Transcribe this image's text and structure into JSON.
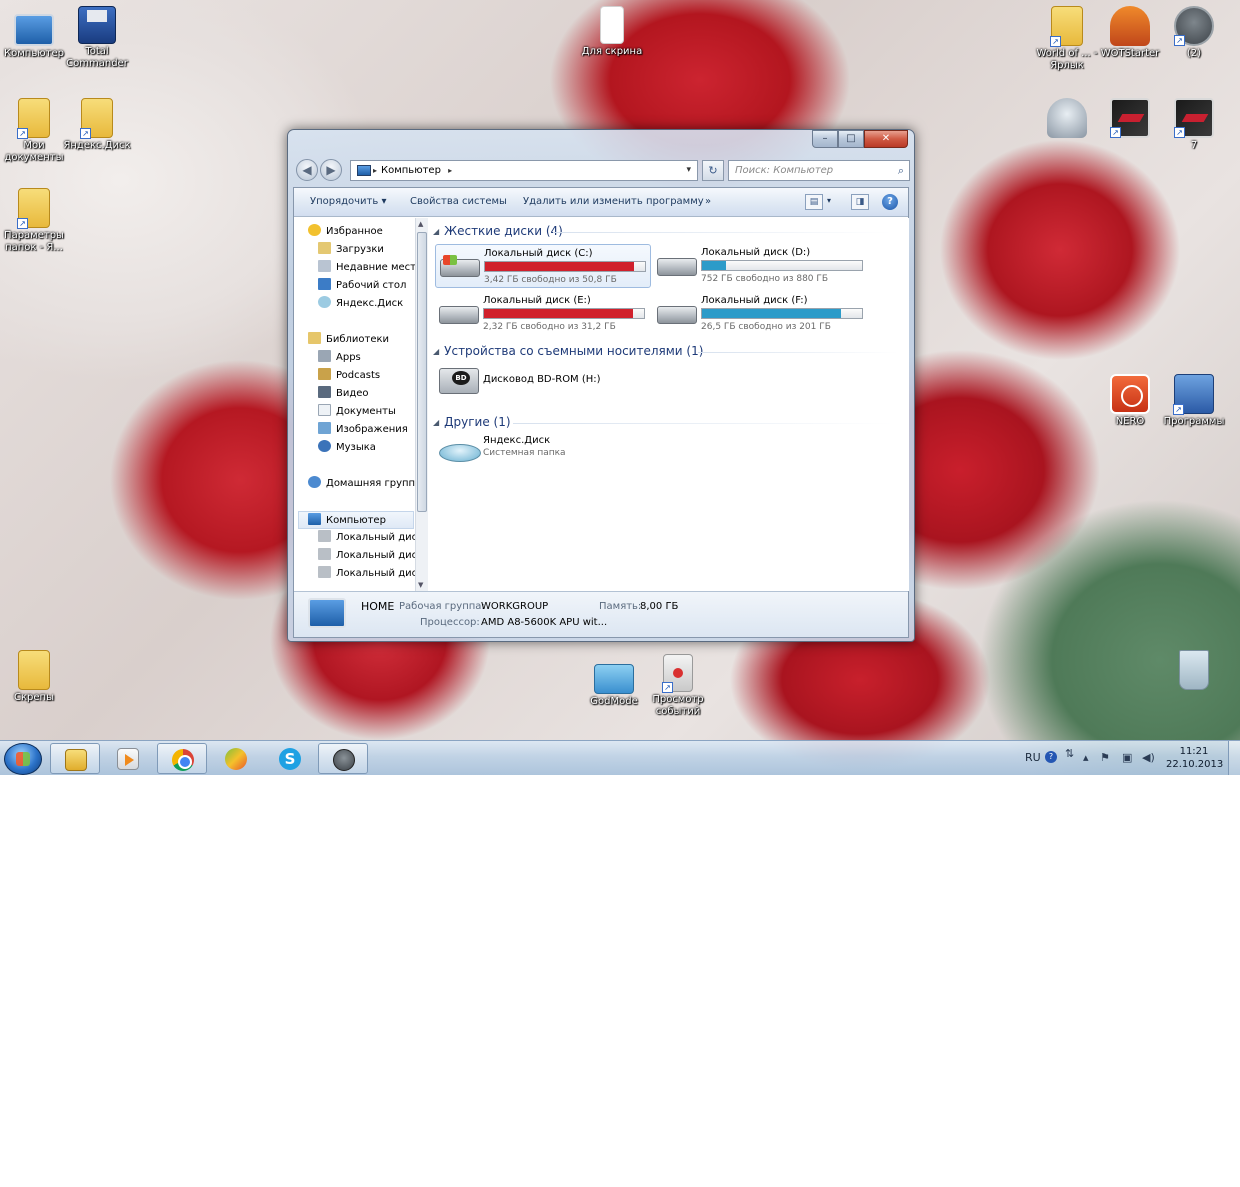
{
  "desktop": {
    "icons_left": [
      {
        "label": "Компьютер",
        "icon": "computer-icon"
      },
      {
        "label": "Total Commander",
        "icon": "floppy-icon"
      },
      {
        "label": "Мои документы",
        "icon": "folder-icon"
      },
      {
        "label": "Яндекс.Диск",
        "icon": "folder-icon"
      },
      {
        "label": "Параметры папок - Я...",
        "icon": "folder-icon"
      },
      {
        "label": "Скрепы",
        "icon": "folder-icon"
      }
    ],
    "icon_for_screenshot": {
      "label": "Для скрина",
      "icon": "blank-file-icon"
    },
    "icons_right": [
      {
        "label": "World of ... - Ярлык",
        "icon": "folder-icon"
      },
      {
        "label": "WOTStarter",
        "icon": "house-icon"
      },
      {
        "label": "(2)",
        "icon": "tank-icon"
      },
      {
        "label": "",
        "icon": "bell-icon"
      },
      {
        "label": "",
        "icon": "nfs-icon"
      },
      {
        "label": "7",
        "icon": "nfs-icon"
      },
      {
        "label": "NERO",
        "icon": "nero-icon"
      },
      {
        "label": "Программы",
        "icon": "programs-icon"
      }
    ],
    "icons_bottom": [
      {
        "label": "GodMode",
        "icon": "control-panel-icon"
      },
      {
        "label": "Просмотр событий",
        "icon": "event-viewer-icon"
      },
      {
        "label": "",
        "icon": "recycle-bin-icon"
      }
    ]
  },
  "window": {
    "caption_buttons": {
      "minimize": "–",
      "maximize": "□",
      "close": "✕"
    },
    "nav": {
      "back": "◀",
      "forward": "▶"
    },
    "address": {
      "path": "Компьютер",
      "separator": "▸"
    },
    "search": {
      "placeholder": "Поиск: Компьютер"
    },
    "commands": [
      "Упорядочить ▾",
      "Свойства системы",
      "Удалить или изменить программу",
      "»"
    ],
    "nav_pane": {
      "favorites": {
        "title": "Избранное",
        "items": [
          "Загрузки",
          "Недавние места",
          "Рабочий стол",
          "Яндекс.Диск"
        ]
      },
      "libraries": {
        "title": "Библиотеки",
        "items": [
          "Apps",
          "Podcasts",
          "Видео",
          "Документы",
          "Изображения",
          "Музыка"
        ]
      },
      "homegroup": "Домашняя группа",
      "computer": {
        "title": "Компьютер",
        "items": [
          "Локальный диск",
          "Локальный диск",
          "Локальный диск"
        ]
      }
    },
    "groups": {
      "hard_drives": "Жесткие диски (4)",
      "removable": "Устройства со съемными носителями (1)",
      "other": "Другие (1)"
    },
    "drives": [
      {
        "name": "Локальный диск (C:)",
        "info": "3,42 ГБ свободно из 50,8 ГБ",
        "used_fraction": 0.93,
        "bar_color": "#d0202c"
      },
      {
        "name": "Локальный диск (D:)",
        "info": "752 ГБ свободно из 880 ГБ",
        "used_fraction": 0.15,
        "bar_color": "#2c9bc9"
      },
      {
        "name": "Локальный диск (E:)",
        "info": "2,32 ГБ свободно из 31,2 ГБ",
        "used_fraction": 0.93,
        "bar_color": "#d0202c"
      },
      {
        "name": "Локальный диск (F:)",
        "info": "26,5 ГБ свободно из 201 ГБ",
        "used_fraction": 0.87,
        "bar_color": "#2c9bc9"
      }
    ],
    "removable": {
      "name": "Дисковод BD-ROM (H:)",
      "badge": "BD"
    },
    "other_item": {
      "name": "Яндекс.Диск",
      "type": "Системная папка"
    },
    "details": {
      "computer_name": "HOME",
      "workgroup_label": "Рабочая группа:",
      "workgroup_value": "WORKGROUP",
      "memory_label": "Память:",
      "memory_value": "8,00 ГБ",
      "cpu_label": "Процессор:",
      "cpu_value": "AMD A8-5600K APU wit..."
    }
  },
  "taskbar": {
    "language": "RU",
    "time": "11:21",
    "date": "22.10.2013",
    "apps": [
      "explorer-icon",
      "media-player-icon",
      "chrome-icon",
      "ball-app-icon",
      "skype-icon",
      "wot-icon"
    ]
  }
}
